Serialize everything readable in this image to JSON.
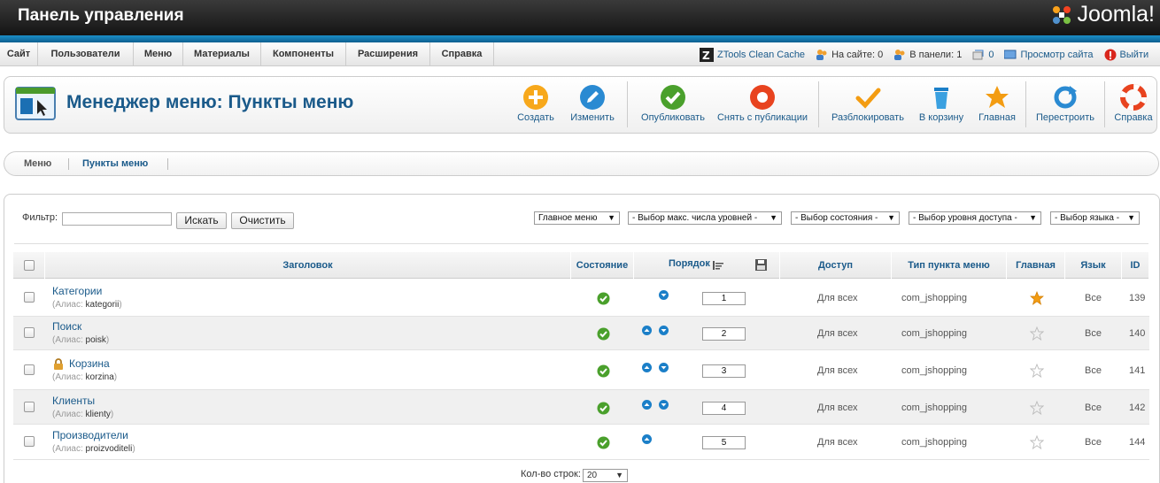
{
  "header": {
    "title": "Панель управления",
    "logo_text": "Joomla!"
  },
  "menubar": {
    "items": [
      "Сайт",
      "Пользователи",
      "Меню",
      "Материалы",
      "Компоненты",
      "Расширения",
      "Справка"
    ],
    "ztools": "ZTools Clean Cache",
    "on_site": "На сайте: 0",
    "in_panel": "В панели: 1",
    "messages": "0",
    "view_site": "Просмотр сайта",
    "logout": "Выйти"
  },
  "toolbar": {
    "title": "Менеджер меню: Пункты меню",
    "buttons": {
      "create": "Создать",
      "edit": "Изменить",
      "publish": "Опубликовать",
      "unpublish": "Снять с публикации",
      "unlock": "Разблокировать",
      "trash": "В корзину",
      "home": "Главная",
      "rebuild": "Перестроить",
      "help": "Справка"
    }
  },
  "submenu": {
    "items": [
      "Меню",
      "Пункты меню"
    ],
    "active": "Пункты меню"
  },
  "filter": {
    "label": "Фильтр:",
    "value": "",
    "search_button": "Искать",
    "clear_button": "Очистить",
    "selects": {
      "menu": "Главное меню",
      "levels": "- Выбор макс. числа уровней -",
      "state": "- Выбор состояния -",
      "access": "- Выбор уровня доступа -",
      "language": "- Выбор языка -"
    }
  },
  "table": {
    "columns": {
      "title": "Заголовок",
      "state": "Состояние",
      "ordering": "Порядок",
      "access": "Доступ",
      "type": "Тип пункта меню",
      "home": "Главная",
      "language": "Язык",
      "id": "ID"
    },
    "alias_prefix": "(Алиас:",
    "rows": [
      {
        "title": "Категории",
        "alias": "kategorii",
        "order": "1",
        "access": "Для всех",
        "type": "com_jshopping",
        "language": "Все",
        "id": "139",
        "is_home": true,
        "locked": false
      },
      {
        "title": "Поиск",
        "alias": "poisk",
        "order": "2",
        "access": "Для всех",
        "type": "com_jshopping",
        "language": "Все",
        "id": "140",
        "is_home": false,
        "locked": false
      },
      {
        "title": "Корзина",
        "alias": "korzina",
        "order": "3",
        "access": "Для всех",
        "type": "com_jshopping",
        "language": "Все",
        "id": "141",
        "is_home": false,
        "locked": true
      },
      {
        "title": "Клиенты",
        "alias": "klienty",
        "order": "4",
        "access": "Для всех",
        "type": "com_jshopping",
        "language": "Все",
        "id": "142",
        "is_home": false,
        "locked": false
      },
      {
        "title": "Производители",
        "alias": "proizvoditeli",
        "order": "5",
        "access": "Для всех",
        "type": "com_jshopping",
        "language": "Все",
        "id": "144",
        "is_home": false,
        "locked": false
      }
    ]
  },
  "pagination": {
    "label": "Кол-во строк:",
    "value": "20"
  },
  "colors": {
    "link": "#1a5a8a",
    "published": "#5aa02c",
    "home_star": "#f39c12",
    "header_bar": "#1b8fc8"
  }
}
